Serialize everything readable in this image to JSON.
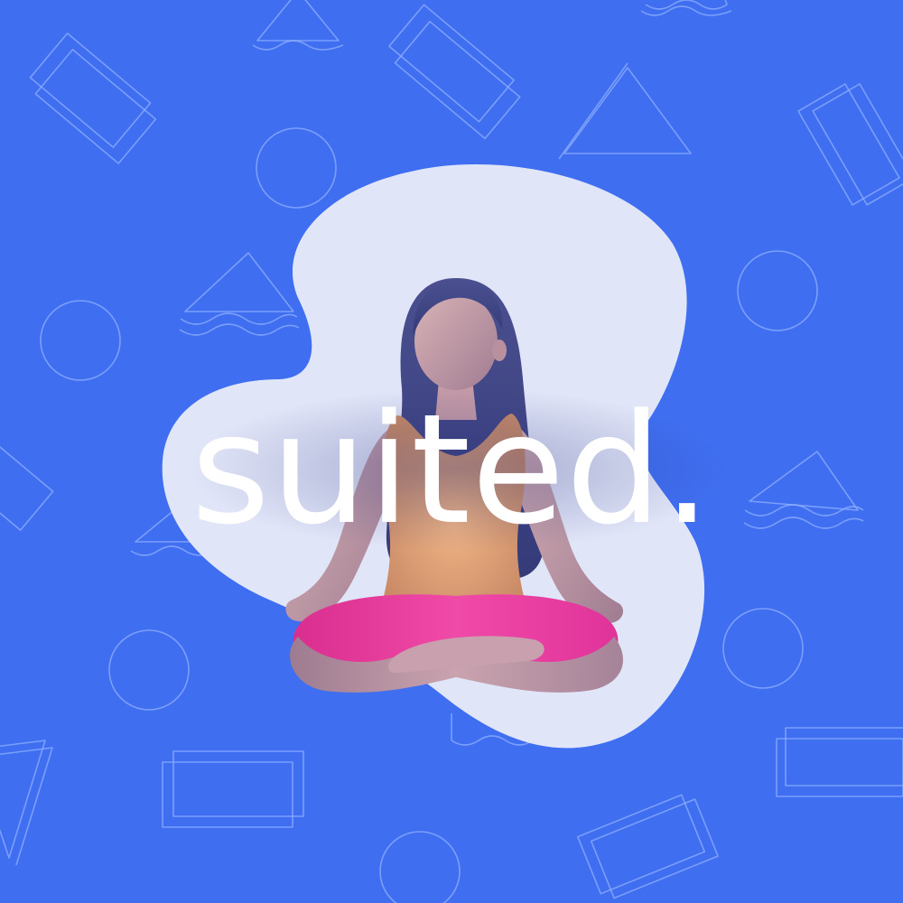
{
  "brand": {
    "wordmark": "suited."
  },
  "colors": {
    "background": "#3f6ef0",
    "pattern_stroke": "#8fb0ff",
    "blob": "#e1e5f8",
    "hair": "#3b4580",
    "skin": "#b08a9a",
    "skin_light": "#d8b2b8",
    "top": "#e5a271",
    "pants": "#e8349a",
    "text": "#ffffff"
  },
  "icons": {
    "pattern": [
      "rectangle-outline-icon",
      "triangle-outline-icon",
      "circle-outline-icon"
    ],
    "figure": "meditating-woman-icon"
  }
}
